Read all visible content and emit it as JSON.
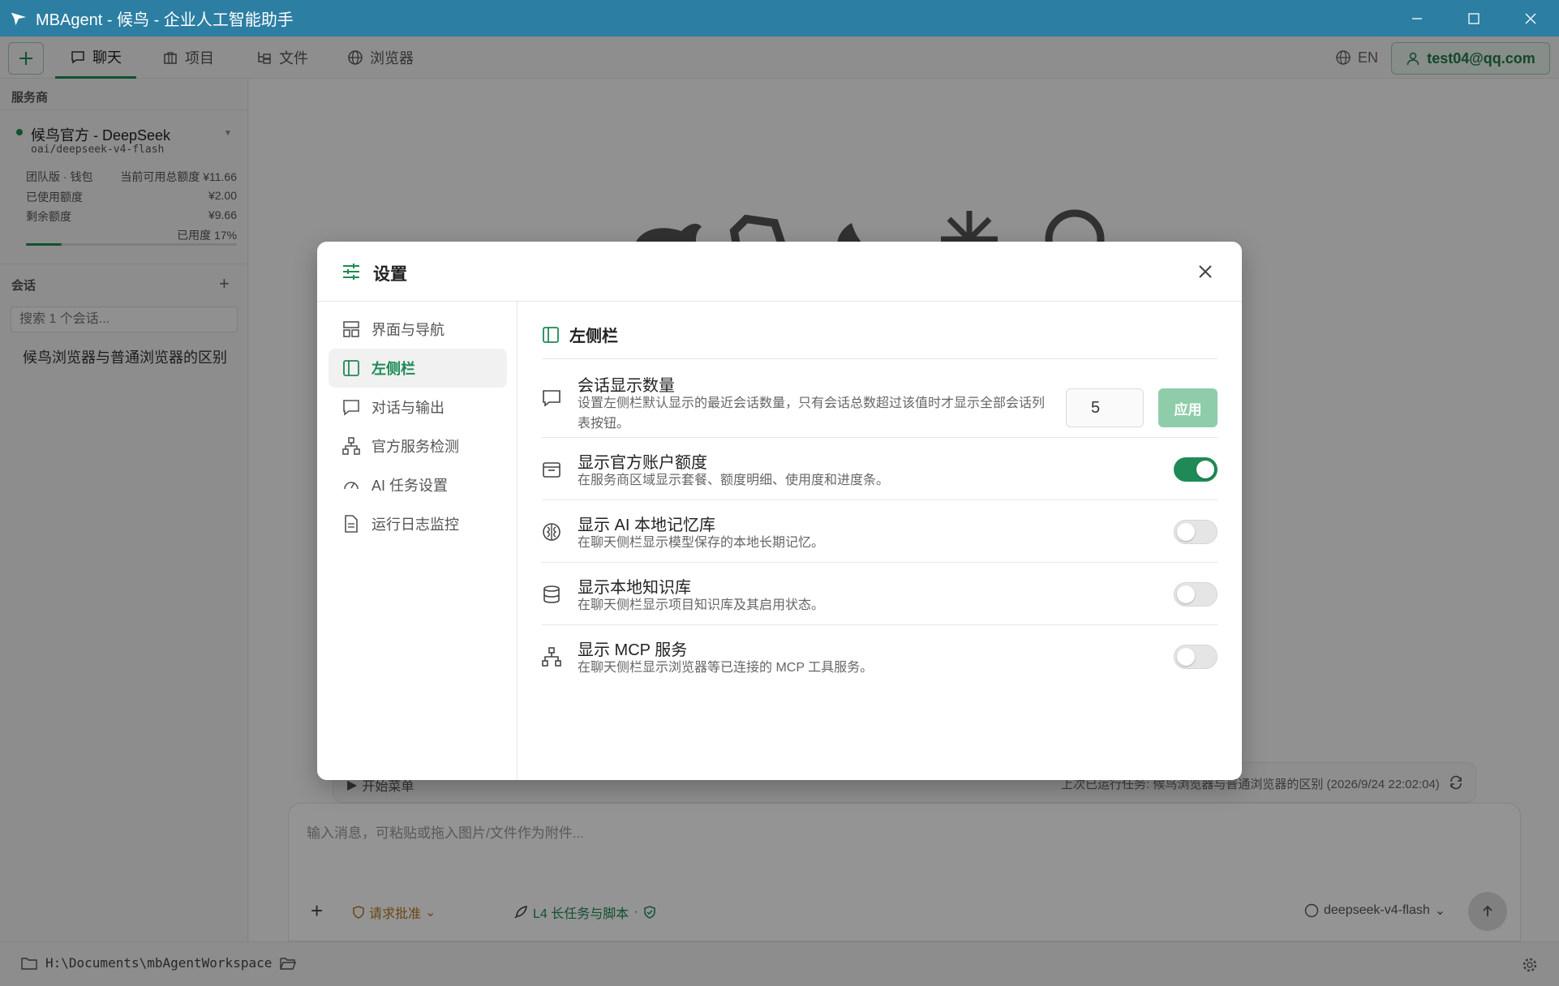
{
  "app": {
    "title": "MBAgent - 候鸟 - 企业人工智能助手"
  },
  "tabs": [
    {
      "label": "聊天",
      "active": true
    },
    {
      "label": "项目",
      "active": false
    },
    {
      "label": "文件",
      "active": false
    },
    {
      "label": "浏览器",
      "active": false
    }
  ],
  "header": {
    "language": "EN",
    "user": "test04@qq.com"
  },
  "sidebar": {
    "provider_section": "服务商",
    "provider": {
      "name": "候鸟官方 - DeepSeek",
      "model": "oai/deepseek-v4-flash",
      "plan": "团队版 · 钱包",
      "available_label": "当前可用总额度 ¥11.66",
      "used_label": "已使用额度",
      "used_value": "¥2.00",
      "remaining_label": "剩余额度",
      "remaining_value": "¥9.66",
      "usage_label": "已用度 17%",
      "usage_fraction": 0.17
    },
    "sessions_section": "会话",
    "search_placeholder": "搜索 1 个会话...",
    "chats": [
      "候鸟浏览器与普通浏览器的区别"
    ]
  },
  "main": {
    "start_label": "开始菜单",
    "last_run": "上次已运行任务: 候鸟浏览器与普通浏览器的区别 (2026/9/24 22:02:04)",
    "composer_placeholder": "输入消息，可粘贴或拖入图片/文件作为附件...",
    "approval": "请求批准",
    "task_level": "L4 长任务与脚本",
    "separator": "·",
    "model": "deepseek-v4-flash"
  },
  "status_bar": {
    "workspace": "H:\\Documents\\mbAgentWorkspace"
  },
  "dialog": {
    "title": "设置",
    "nav": [
      {
        "label": "界面与导航",
        "icon": "layout-icon",
        "active": false
      },
      {
        "label": "左侧栏",
        "icon": "sidebar-icon",
        "active": true
      },
      {
        "label": "对话与输出",
        "icon": "chat-icon",
        "active": false
      },
      {
        "label": "官方服务检测",
        "icon": "network-icon",
        "active": false
      },
      {
        "label": "AI 任务设置",
        "icon": "gauge-icon",
        "active": false
      },
      {
        "label": "运行日志监控",
        "icon": "document-icon",
        "active": false
      }
    ],
    "section_title": "左侧栏",
    "settings": {
      "session_count": {
        "title": "会话显示数量",
        "desc": "设置左侧栏默认显示的最近会话数量，只有会话总数超过该值时才显示全部会话列表按钮。",
        "value": "5",
        "apply_label": "应用"
      },
      "show_quota": {
        "title": "显示官方账户额度",
        "desc": "在服务商区域显示套餐、额度明细、使用度和进度条。",
        "enabled": true
      },
      "show_memory": {
        "title": "显示 AI 本地记忆库",
        "desc": "在聊天侧栏显示模型保存的本地长期记忆。",
        "enabled": false
      },
      "show_kb": {
        "title": "显示本地知识库",
        "desc": "在聊天侧栏显示项目知识库及其启用状态。",
        "enabled": false
      },
      "show_mcp": {
        "title": "显示 MCP 服务",
        "desc": "在聊天侧栏显示浏览器等已连接的 MCP 工具服务。",
        "enabled": false
      }
    }
  },
  "colors": {
    "accent": "#1f8a55",
    "titlebar": "#2c7ea3",
    "approval": "#b7791f"
  }
}
